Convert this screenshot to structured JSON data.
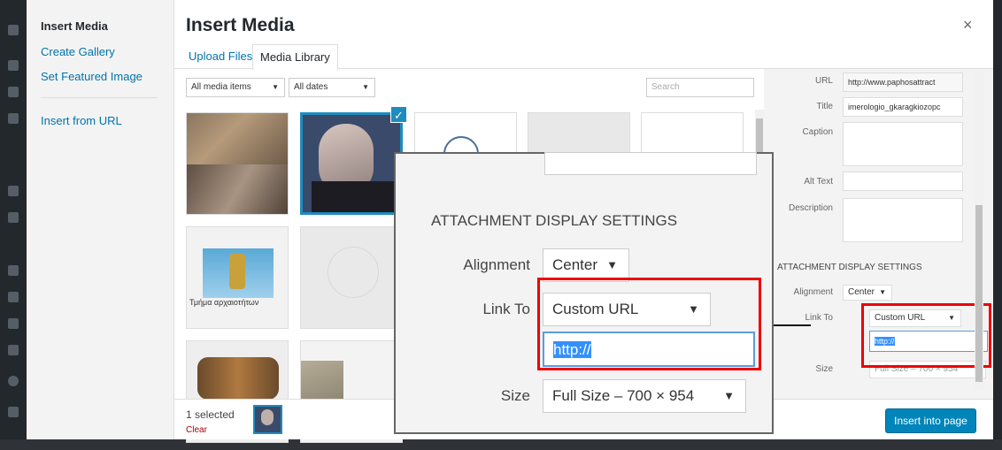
{
  "menu": {
    "title": "Insert Media",
    "items": [
      "Create Gallery",
      "Set Featured Image"
    ],
    "insert_url": "Insert from URL"
  },
  "frame": {
    "title": "Insert Media",
    "close_glyph": "×"
  },
  "tabs": {
    "upload": "Upload Files",
    "library": "Media Library"
  },
  "filters": {
    "type": "All media items",
    "date": "All dates",
    "search_placeholder": "Search"
  },
  "thumb_captions": {
    "t6": "Τμήμα αρχαιοτήτων"
  },
  "sidebar": {
    "url_label": "URL",
    "url_value": "http://www.paphosattract",
    "title_label": "Title",
    "title_value": "imerologio_gkaragkiozopc",
    "caption_label": "Caption",
    "alt_label": "Alt Text",
    "description_label": "Description",
    "heading": "ATTACHMENT DISPLAY SETTINGS",
    "alignment_label": "Alignment",
    "alignment_value": "Center",
    "link_label": "Link To",
    "link_value": "Custom URL",
    "url_input": "http://",
    "size_label": "Size",
    "size_value": "Full Size – 700 × 954"
  },
  "zoom": {
    "heading": "ATTACHMENT DISPLAY SETTINGS",
    "alignment_label": "Alignment",
    "alignment_value": "Center",
    "link_label": "Link To",
    "link_value": "Custom URL",
    "url_input": "http://",
    "size_label": "Size",
    "size_value": "Full Size – 700 × 954"
  },
  "footer": {
    "selected": "1 selected",
    "clear": "Clear",
    "insert_button": "Insert into page"
  },
  "colors": {
    "accent": "#0073aa",
    "primary_button": "#0085ba",
    "annotation_red": "#e00000",
    "selection_border": "#1e8cbe"
  }
}
